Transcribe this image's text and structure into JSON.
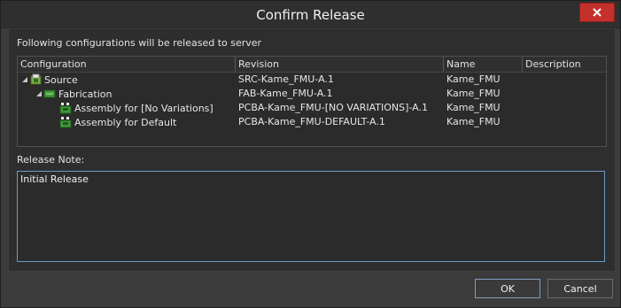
{
  "window": {
    "title": "Confirm Release"
  },
  "intro_text": "Following configurations will be released to server",
  "table": {
    "columns": [
      "Configuration",
      "Revision",
      "Name",
      "Description"
    ],
    "rows": [
      {
        "configuration": "Source",
        "revision": "SRC-Kame_FMU-A.1",
        "name": "Kame_FMU",
        "description": "",
        "icon": "source-icon",
        "level": 0,
        "expanded": true
      },
      {
        "configuration": "Fabrication",
        "revision": "FAB-Kame_FMU-A.1",
        "name": "Kame_FMU",
        "description": "",
        "icon": "fabrication-icon",
        "level": 1,
        "expanded": true
      },
      {
        "configuration": "Assembly for [No Variations]",
        "revision": "PCBA-Kame_FMU-[NO VARIATIONS]-A.1",
        "name": "Kame_FMU",
        "description": "",
        "icon": "assembly-icon",
        "level": 2
      },
      {
        "configuration": "Assembly for Default",
        "revision": "PCBA-Kame_FMU-DEFAULT-A.1",
        "name": "Kame_FMU",
        "description": "",
        "icon": "assembly-icon",
        "level": 2
      }
    ]
  },
  "release_note": {
    "label": "Release Note:",
    "value": "Initial Release"
  },
  "buttons": {
    "ok": "OK",
    "cancel": "Cancel"
  },
  "colors": {
    "accent": "#6a9bc4",
    "close": "#c4302b"
  }
}
